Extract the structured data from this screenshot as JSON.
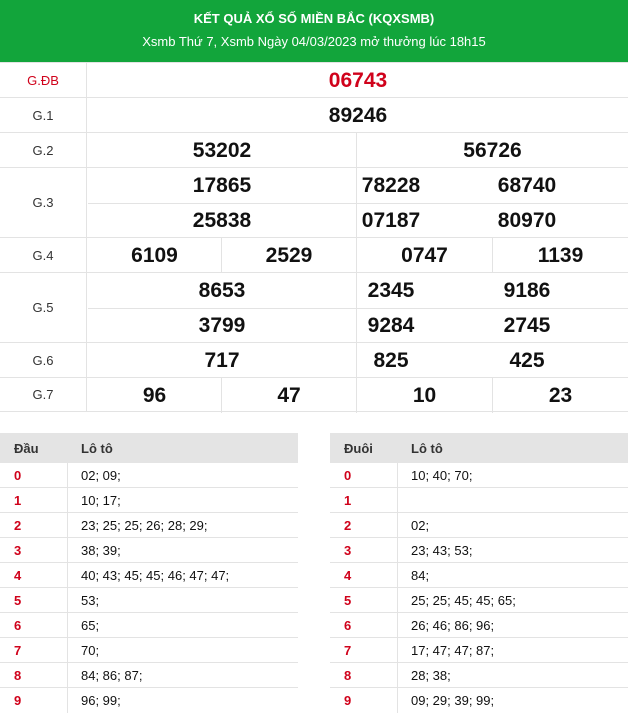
{
  "header": {
    "title": "KẾT QUẢ XỔ SỐ MIỀN BẮC (KQXSMB)",
    "subtitle": "Xsmb Thứ 7, Xsmb Ngày 04/03/2023 mở thưởng lúc 18h15"
  },
  "prizes": {
    "db": {
      "label": "G.ĐB",
      "numbers": [
        "06743"
      ]
    },
    "g1": {
      "label": "G.1",
      "numbers": [
        "89246"
      ]
    },
    "g2": {
      "label": "G.2",
      "numbers": [
        "53202",
        "56726"
      ]
    },
    "g3": {
      "label": "G.3",
      "numbers": [
        "17865",
        "78228",
        "68740",
        "25838",
        "07187",
        "80970"
      ]
    },
    "g4": {
      "label": "G.4",
      "numbers": [
        "6109",
        "2529",
        "0747",
        "1139"
      ]
    },
    "g5": {
      "label": "G.5",
      "numbers": [
        "8653",
        "2345",
        "9186",
        "3799",
        "9284",
        "2745"
      ]
    },
    "g6": {
      "label": "G.6",
      "numbers": [
        "717",
        "825",
        "425"
      ]
    },
    "g7": {
      "label": "G.7",
      "numbers": [
        "96",
        "47",
        "10",
        "23"
      ]
    }
  },
  "head_table": {
    "col1": "Đầu",
    "col2": "Lô tô",
    "rows": [
      {
        "key": "0",
        "value": "02; 09;"
      },
      {
        "key": "1",
        "value": "10; 17;"
      },
      {
        "key": "2",
        "value": "23; 25; 25; 26; 28; 29;"
      },
      {
        "key": "3",
        "value": "38; 39;"
      },
      {
        "key": "4",
        "value": "40; 43; 45; 45; 46; 47; 47;"
      },
      {
        "key": "5",
        "value": "53;"
      },
      {
        "key": "6",
        "value": "65;"
      },
      {
        "key": "7",
        "value": "70;"
      },
      {
        "key": "8",
        "value": "84; 86; 87;"
      },
      {
        "key": "9",
        "value": "96; 99;"
      }
    ]
  },
  "tail_table": {
    "col1": "Đuôi",
    "col2": "Lô tô",
    "rows": [
      {
        "key": "0",
        "value": "10; 40; 70;"
      },
      {
        "key": "1",
        "value": ""
      },
      {
        "key": "2",
        "value": "02;"
      },
      {
        "key": "3",
        "value": "23; 43; 53;"
      },
      {
        "key": "4",
        "value": "84;"
      },
      {
        "key": "5",
        "value": "25; 25; 45; 45; 65;"
      },
      {
        "key": "6",
        "value": "26; 46; 86; 96;"
      },
      {
        "key": "7",
        "value": "17; 47; 47; 87;"
      },
      {
        "key": "8",
        "value": "28; 38;"
      },
      {
        "key": "9",
        "value": "09; 29; 39; 99;"
      }
    ]
  },
  "colors": {
    "header_bg": "#12a53b",
    "accent_red": "#d0021b",
    "table_head_bg": "#e4e4e4"
  }
}
